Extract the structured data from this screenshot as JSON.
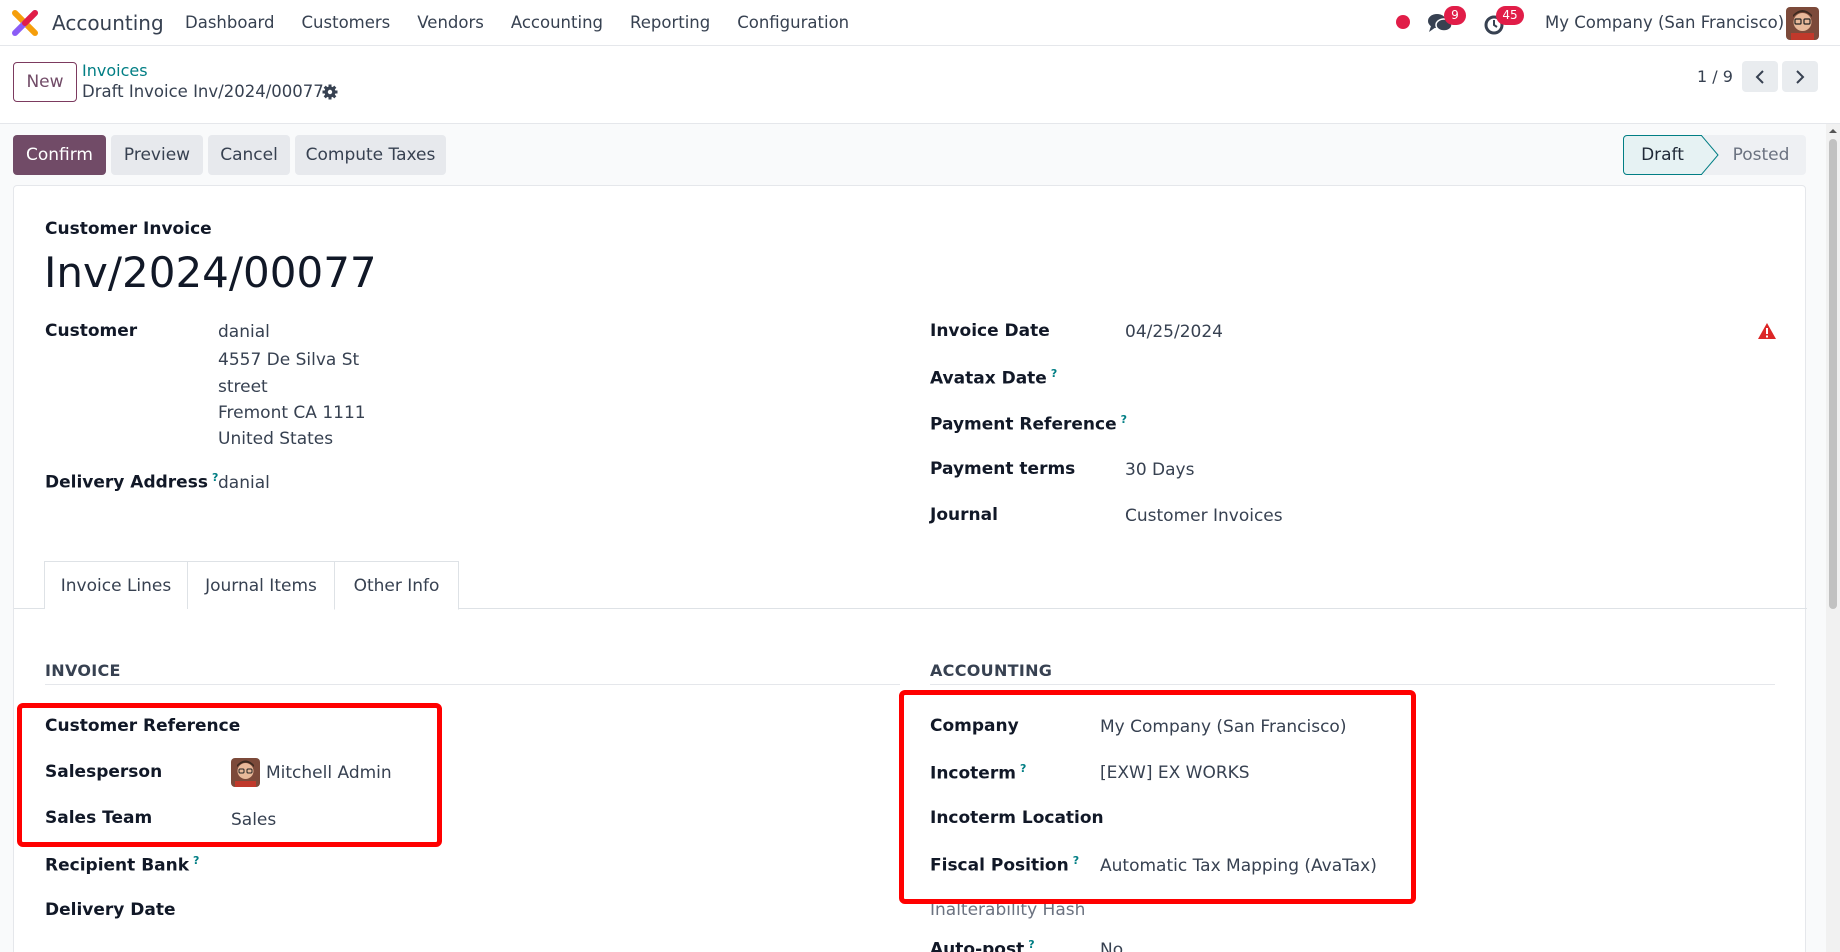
{
  "navbar": {
    "app_name": "Accounting",
    "menu": [
      "Dashboard",
      "Customers",
      "Vendors",
      "Accounting",
      "Reporting",
      "Configuration"
    ],
    "chat_count": "9",
    "activity_count": "45",
    "company": "My Company (San Francisco)"
  },
  "control_panel": {
    "new_label": "New",
    "breadcrumb_parent": "Invoices",
    "breadcrumb_current": "Draft Invoice Inv/2024/00077",
    "pager": "1 / 9"
  },
  "actions": {
    "confirm": "Confirm",
    "preview": "Preview",
    "cancel": "Cancel",
    "compute_taxes": "Compute Taxes",
    "status_draft": "Draft",
    "status_posted": "Posted"
  },
  "form": {
    "doc_kind": "Customer Invoice",
    "doc_name": "Inv/2024/00077",
    "customer_label": "Customer",
    "customer_lines": [
      "danial",
      "4557 De Silva St",
      "street",
      "Fremont CA 1111",
      "United States"
    ],
    "delivery_address_label": "Delivery Address",
    "delivery_address_value": "danial",
    "invoice_date_label": "Invoice Date",
    "invoice_date_value": "04/25/2024",
    "avatax_date_label": "Avatax Date",
    "payment_reference_label": "Payment Reference",
    "payment_terms_label": "Payment terms",
    "payment_terms_value": "30 Days",
    "journal_label": "Journal",
    "journal_value": "Customer Invoices",
    "help_mark": "?"
  },
  "tabs": [
    "Invoice Lines",
    "Journal Items",
    "Other Info"
  ],
  "invoice_section": {
    "title": "INVOICE",
    "customer_reference_label": "Customer Reference",
    "salesperson_label": "Salesperson",
    "salesperson_value": "Mitchell Admin",
    "sales_team_label": "Sales Team",
    "sales_team_value": "Sales",
    "recipient_bank_label": "Recipient Bank",
    "delivery_date_label": "Delivery Date"
  },
  "accounting_section": {
    "title": "ACCOUNTING",
    "company_label": "Company",
    "company_value": "My Company (San Francisco)",
    "incoterm_label": "Incoterm",
    "incoterm_value": "[EXW] EX WORKS",
    "incoterm_location_label": "Incoterm Location",
    "fiscal_position_label": "Fiscal Position",
    "fiscal_position_value": "Automatic Tax Mapping (AvaTax)",
    "inalterability_label": "Inalterability Hash",
    "auto_post_label": "Auto-post",
    "auto_post_value": "No"
  },
  "colors": {
    "brand": "#714b67",
    "link": "#017e84",
    "badge": "#e11d48",
    "highlight": "#ff0000"
  }
}
